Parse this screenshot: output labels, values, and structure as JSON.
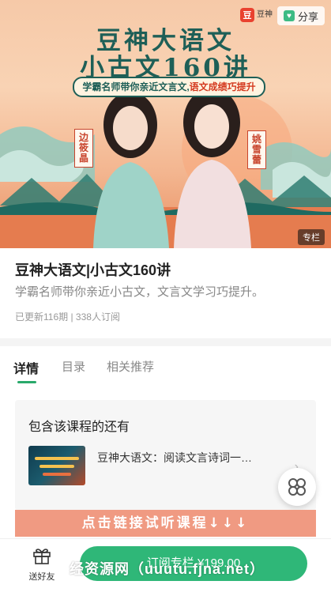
{
  "banner": {
    "brand_name": "豆神",
    "share_label": "分享",
    "title_line1": "豆神大语文",
    "title_line2": "小古文160讲",
    "tagline_a": "学霸名师带你亲近文言文,",
    "tagline_b": "语文成绩巧提升",
    "teacher_left": "边筱晶",
    "teacher_right": "姚雪蕾",
    "column_badge": "专栏"
  },
  "course": {
    "title": "豆神大语文|小古文160讲",
    "subtitle": "学霸名师带你亲近小古文，文言文学习巧提升。",
    "meta": "已更新116期 | 338人订阅"
  },
  "tabs": [
    "详情",
    "目录",
    "相关推荐"
  ],
  "included": {
    "heading": "包含该课程的还有",
    "item_title": "豆神大语文：阅读文言诗词一…"
  },
  "promo_text": "点击链接试听课程↓↓↓",
  "bottom_bar": {
    "gift_label": "送好友",
    "subscribe_label": "订阅专栏 ¥199.00"
  },
  "watermark": "经资源网（uuutu.fjna.net）",
  "colors": {
    "accent_green": "#2fb778",
    "promo_bg": "#f09a82",
    "title_teal": "#1e5f57"
  },
  "icons": {
    "share": "heart-share-icon",
    "gift": "gift-icon",
    "float": "clover-icon",
    "chevron": "chevron-right-icon"
  }
}
